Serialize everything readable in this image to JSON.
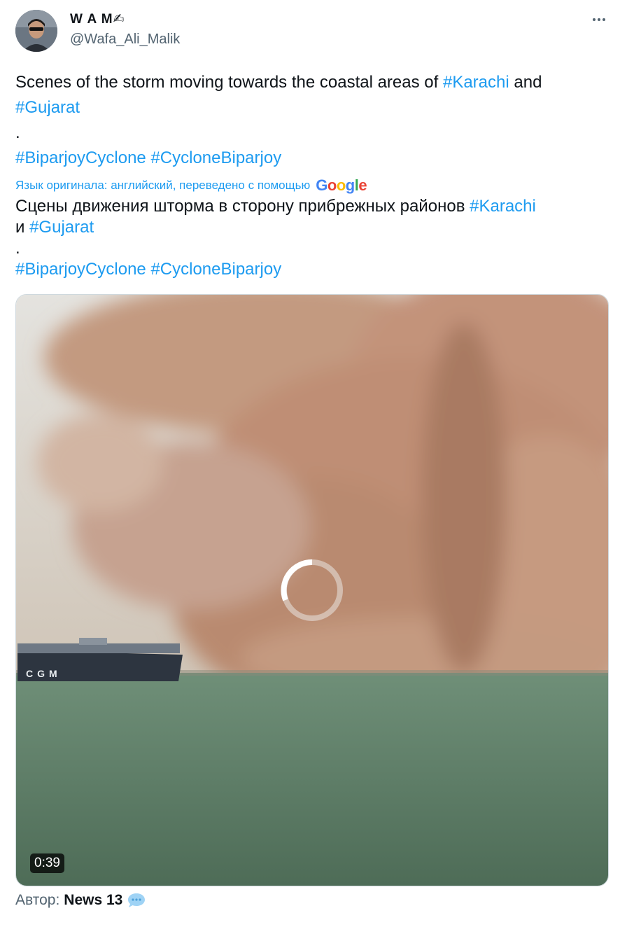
{
  "author": {
    "name": "W A M✍",
    "handle": "@Wafa_Ali_Malik"
  },
  "tweet": {
    "original_text": "Scenes of the storm moving towards the coastal areas of ",
    "original_tag1": "#Karachi",
    "original_and": " and",
    "original_tag2": "#Gujarat",
    "dot": ".",
    "original_tag3": "#BiparjoyCyclone",
    "original_tag4": "#CycloneBiparjoy",
    "translation_note": "Язык оригинала: английский, переведено с помощью",
    "translation_provider": "Google",
    "translated_text": "Сцены движения шторма в сторону прибрежных районов ",
    "translated_tag1": "#Karachi",
    "translated_and": "и ",
    "translated_tag2": "#Gujarat",
    "translated_dot": ".",
    "translated_tag3": "#BiparjoyCyclone",
    "translated_tag4": "#CycloneBiparjoy"
  },
  "media": {
    "duration": "0:39",
    "ship_text": "CGM"
  },
  "attribution": {
    "label": "Автор:",
    "source": "News 13"
  },
  "colors": {
    "accent": "#1d9bf0",
    "secondary_text": "#536471"
  }
}
